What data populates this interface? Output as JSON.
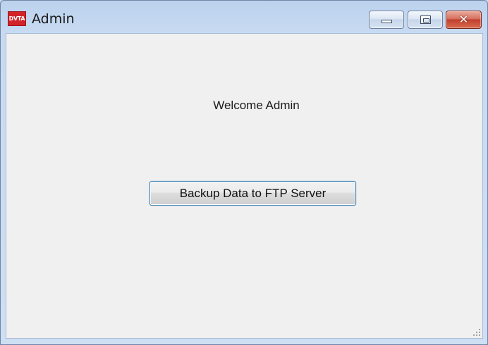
{
  "window": {
    "title": "Admin",
    "icon_text": "DVTA",
    "icon_color": "#d3232a",
    "controls": {
      "minimize_icon": "minimize-icon",
      "maximize_icon": "maximize-icon",
      "close_icon": "close-icon",
      "close_glyph": "✕"
    }
  },
  "main": {
    "welcome_text": "Welcome Admin",
    "backup_button_label": "Backup Data to FTP Server",
    "button_border_color": "#3c7fb1"
  }
}
